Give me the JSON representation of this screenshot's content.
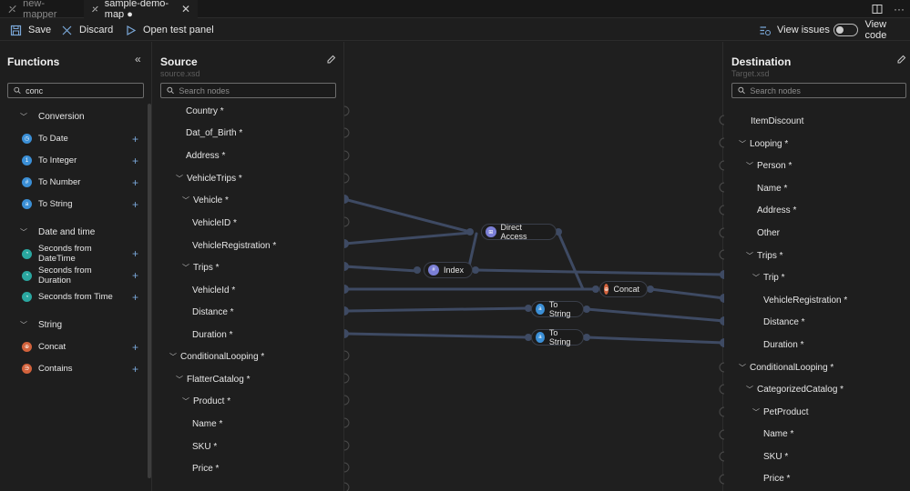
{
  "tabs": [
    {
      "label": "new-mapper",
      "active": false
    },
    {
      "label": "sample-demo-map ●",
      "active": true
    }
  ],
  "toolbar": {
    "save": "Save",
    "discard": "Discard",
    "open_test": "Open test panel",
    "view_issues": "View issues",
    "view_code": "View code"
  },
  "functions": {
    "title": "Functions",
    "search_value": "conc",
    "categories": [
      {
        "label": "Conversion",
        "items": [
          "To Date",
          "To Integer",
          "To Number",
          "To String"
        ]
      },
      {
        "label": "Date and time",
        "items": [
          "Seconds from DateTime",
          "Seconds from Duration",
          "Seconds from Time"
        ]
      },
      {
        "label": "String",
        "items": [
          "Concat",
          "Contains"
        ]
      }
    ]
  },
  "source": {
    "title": "Source",
    "subtitle": "source.xsd",
    "search_placeholder": "Search nodes",
    "nodes": [
      "Country *",
      "Dat_of_Birth *",
      "Address *",
      "VehicleTrips *",
      "Vehicle *",
      "VehicleID *",
      "VehicleRegistration *",
      "Trips *",
      "VehicleId *",
      "Distance *",
      "Duration *",
      "ConditionalLooping *",
      "FlatterCatalog *",
      "Product *",
      "Name *",
      "SKU *",
      "Price *"
    ]
  },
  "destination": {
    "title": "Destination",
    "subtitle": "Target.xsd",
    "search_placeholder": "Search nodes",
    "nodes": [
      "ItemDiscount",
      "Looping *",
      "Person *",
      "Name *",
      "Address *",
      "Other",
      "Trips *",
      "Trip *",
      "VehicleRegistration *",
      "Distance *",
      "Duration *",
      "ConditionalLooping *",
      "CategorizedCatalog *",
      "PetProduct",
      "Name *",
      "SKU *",
      "Price *"
    ]
  },
  "canvas_functions": {
    "direct_access": "Direct Access",
    "index": "Index",
    "concat": "Concat",
    "to_string_1": "To String",
    "to_string_2": "To String"
  },
  "colors": {
    "conversion_icon": "#3b8fd6",
    "date_icon": "#2aa7a0",
    "string_icon": "#d2623c",
    "edge": "#3e4a63",
    "accent_link": "#7aa7d8"
  }
}
